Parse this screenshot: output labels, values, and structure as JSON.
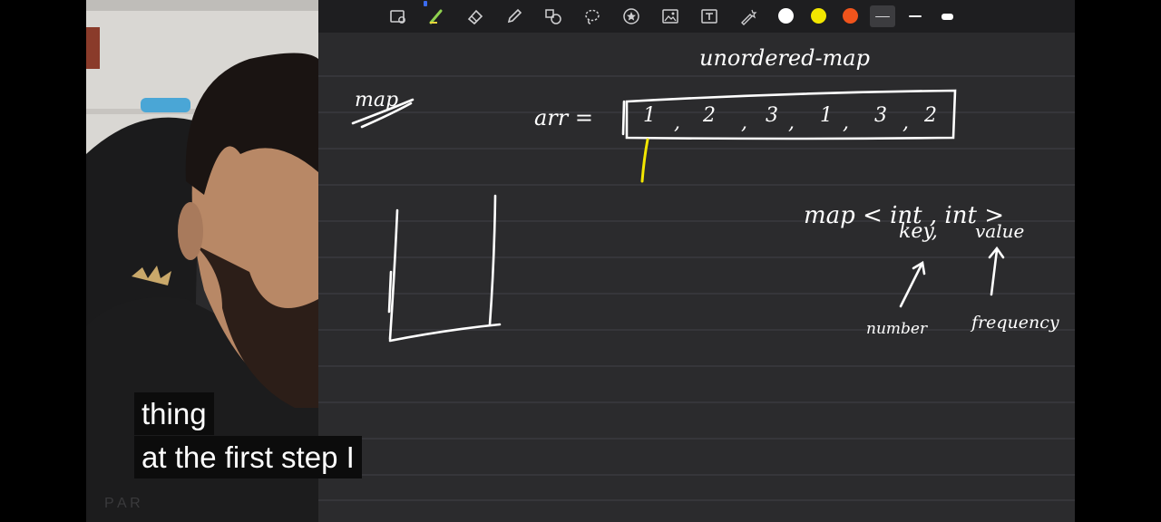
{
  "toolbar": {
    "tools": [
      {
        "name": "lasso-image-tool",
        "icon": "image-select-icon"
      },
      {
        "name": "highlighter-tool",
        "icon": "highlighter-icon"
      },
      {
        "name": "eraser-tool",
        "icon": "eraser-icon"
      },
      {
        "name": "pencil-tool",
        "icon": "pencil-icon"
      },
      {
        "name": "shapes-tool",
        "icon": "shapes-icon"
      },
      {
        "name": "lasso-tool",
        "icon": "lasso-icon"
      },
      {
        "name": "sticker-tool",
        "icon": "star-circle-icon"
      },
      {
        "name": "image-tool",
        "icon": "image-icon"
      },
      {
        "name": "text-tool",
        "icon": "text-box-icon"
      },
      {
        "name": "laser-tool",
        "icon": "laser-pointer-icon"
      }
    ],
    "colors": [
      "#ffffff",
      "#f2e600",
      "#f0541c"
    ],
    "active_tool_indicator_color": "#3b6cf0"
  },
  "board": {
    "background": "#2b2b2d",
    "line_color": "#3a3a3d",
    "handwriting": {
      "title": "unordered-map",
      "heading": "map",
      "array_label": "arr =",
      "array_values": [
        "1",
        "2",
        "3",
        "1",
        "3",
        "2"
      ],
      "map_expression": "map < int , int >",
      "key_label": "key,",
      "value_label": "value",
      "key_note": "number",
      "value_note": "frequency"
    }
  },
  "captions": {
    "line1": "thing",
    "line2": "at the first step I"
  }
}
